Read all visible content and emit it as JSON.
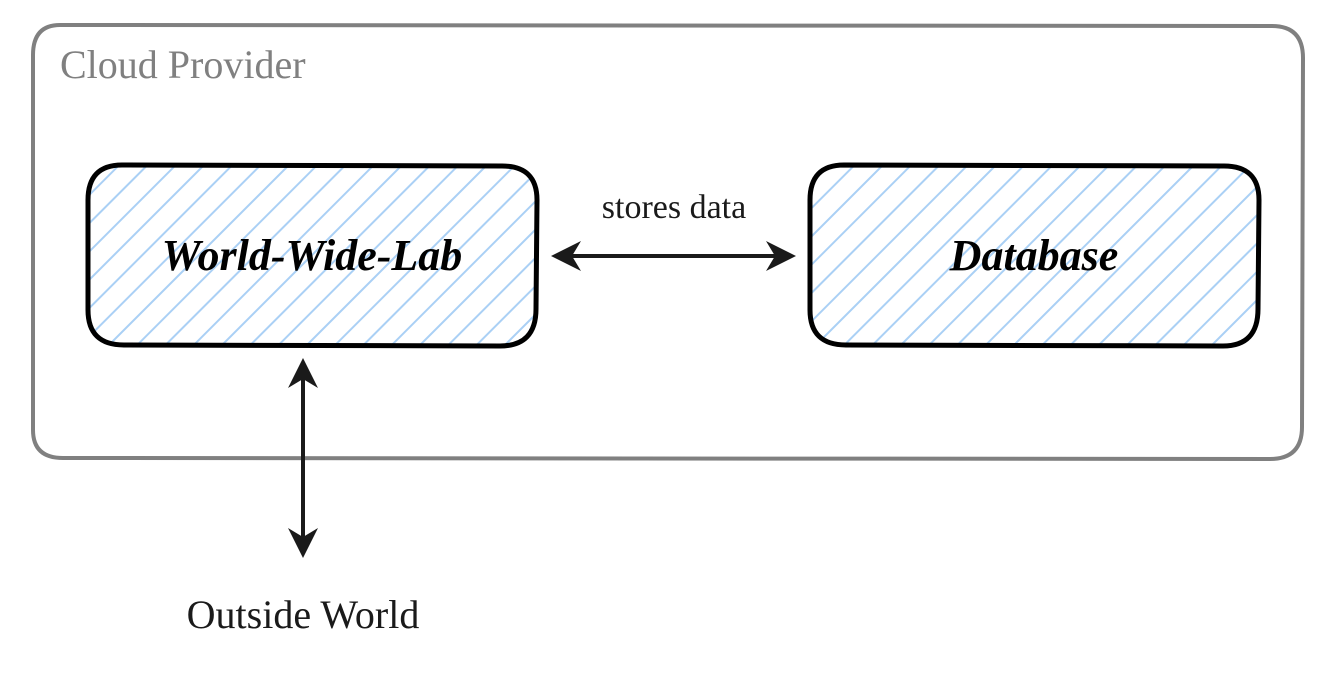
{
  "diagram": {
    "container": {
      "label": "Cloud Provider"
    },
    "nodes": {
      "wwl": {
        "label": "World-Wide-Lab"
      },
      "db": {
        "label": "Database"
      }
    },
    "edges": {
      "stores": {
        "label": "stores data"
      }
    },
    "external": {
      "outside": {
        "label": "Outside World"
      }
    }
  }
}
